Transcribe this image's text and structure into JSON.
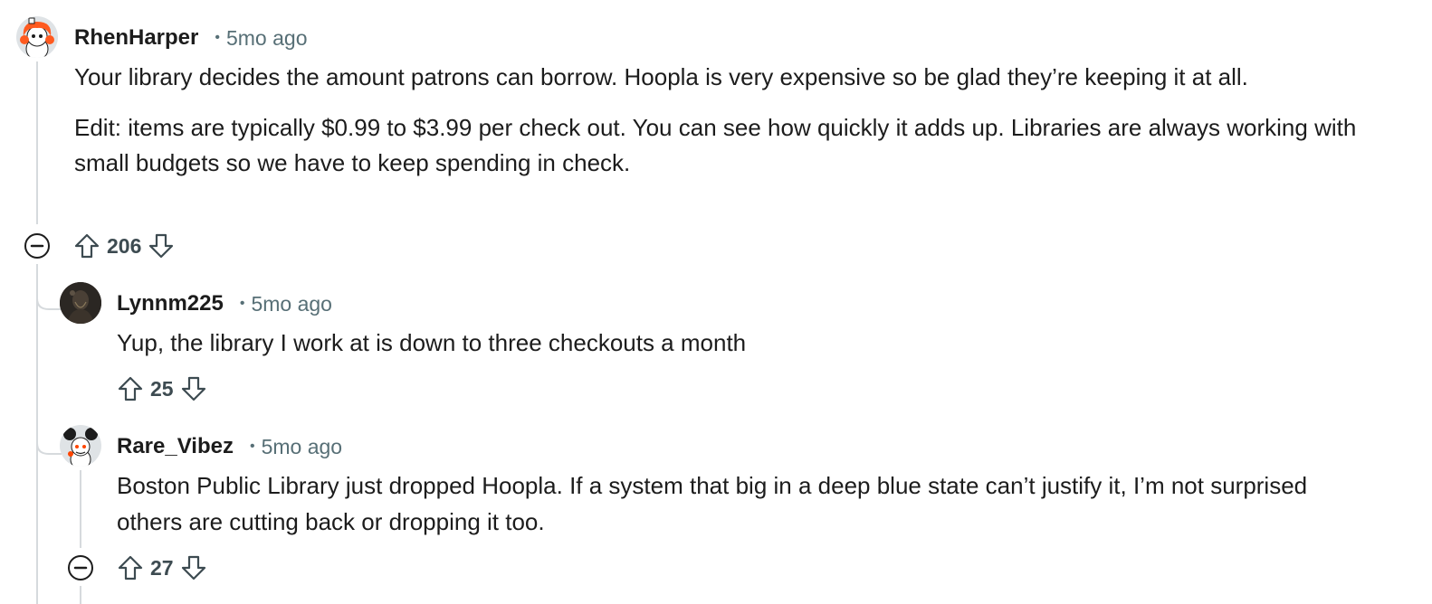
{
  "comments": [
    {
      "author": "RhenHarper",
      "separator": "•",
      "time": "5mo ago",
      "avatar_icon": "snoo-avatar-orange-hair-icon",
      "paragraphs": [
        "Your library decides the amount patrons can borrow. Hoopla is very expensive so be glad they’re keeping it at all.",
        "Edit: items are typically $0.99 to $3.99 per check out. You can see how quickly it adds up. Libraries are always working with small budgets so we have to keep spending in check."
      ],
      "score": "206"
    },
    {
      "author": "Lynnm225",
      "separator": "•",
      "time": "5mo ago",
      "avatar_icon": "photo-avatar-icon",
      "paragraphs": [
        "Yup, the library I work at is down to three checkouts a month"
      ],
      "score": "25"
    },
    {
      "author": "Rare_Vibez",
      "separator": "•",
      "time": "5mo ago",
      "avatar_icon": "snoo-avatar-mouse-ears-icon",
      "paragraphs": [
        "Boston Public Library just dropped Hoopla. If a system that big in a deep blue state can’t justify it, I’m not surprised others are cutting back or dropping it too."
      ],
      "score": "27"
    }
  ],
  "colors": {
    "text": "#1c1c1c",
    "meta": "#576f76",
    "score": "#3d4b51",
    "thread_line": "#d6dadd"
  }
}
